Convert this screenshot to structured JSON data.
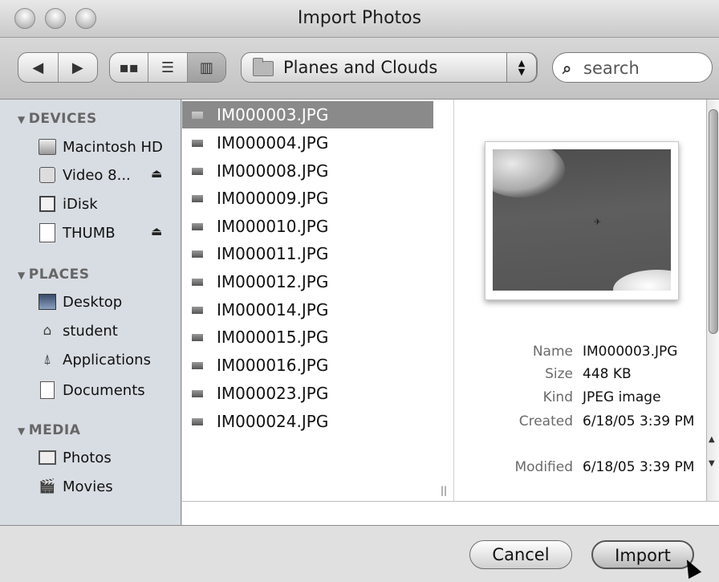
{
  "window": {
    "title": "Import Photos"
  },
  "toolbar": {
    "back_icon": "triangle-left-icon",
    "forward_icon": "triangle-right-icon",
    "views": [
      "icon-view-icon",
      "list-view-icon",
      "column-view-icon"
    ],
    "active_view": "column",
    "location": "Planes and Clouds",
    "search_placeholder": "search"
  },
  "sidebar": {
    "sections": [
      {
        "label": "DEVICES",
        "items": [
          {
            "label": "Macintosh HD",
            "icon": "hard-drive-icon"
          },
          {
            "label": "Video 8...",
            "icon": "video-drive-icon",
            "eject": true
          },
          {
            "label": "iDisk",
            "icon": "idisk-icon"
          },
          {
            "label": "THUMB",
            "icon": "thumb-drive-icon",
            "eject": true
          }
        ]
      },
      {
        "label": "PLACES",
        "items": [
          {
            "label": "Desktop",
            "icon": "desktop-icon"
          },
          {
            "label": "student",
            "icon": "home-icon"
          },
          {
            "label": "Applications",
            "icon": "applications-icon"
          },
          {
            "label": "Documents",
            "icon": "documents-icon"
          }
        ]
      },
      {
        "label": "MEDIA",
        "items": [
          {
            "label": "Photos",
            "icon": "photos-icon"
          },
          {
            "label": "Movies",
            "icon": "movies-icon"
          }
        ]
      }
    ]
  },
  "files": [
    "IM000003.JPG",
    "IM000004.JPG",
    "IM000008.JPG",
    "IM000009.JPG",
    "IM000010.JPG",
    "IM000011.JPG",
    "IM000012.JPG",
    "IM000014.JPG",
    "IM000015.JPG",
    "IM000016.JPG",
    "IM000023.JPG",
    "IM000024.JPG"
  ],
  "selected_file": "IM000003.JPG",
  "preview": {
    "name_label": "Name",
    "name": "IM000003.JPG",
    "size_label": "Size",
    "size": "448 KB",
    "kind_label": "Kind",
    "kind": "JPEG image",
    "created_label": "Created",
    "created": "6/18/05 3:39 PM",
    "modified_label": "Modified",
    "modified": "6/18/05 3:39 PM"
  },
  "buttons": {
    "cancel": "Cancel",
    "import": "Import"
  }
}
